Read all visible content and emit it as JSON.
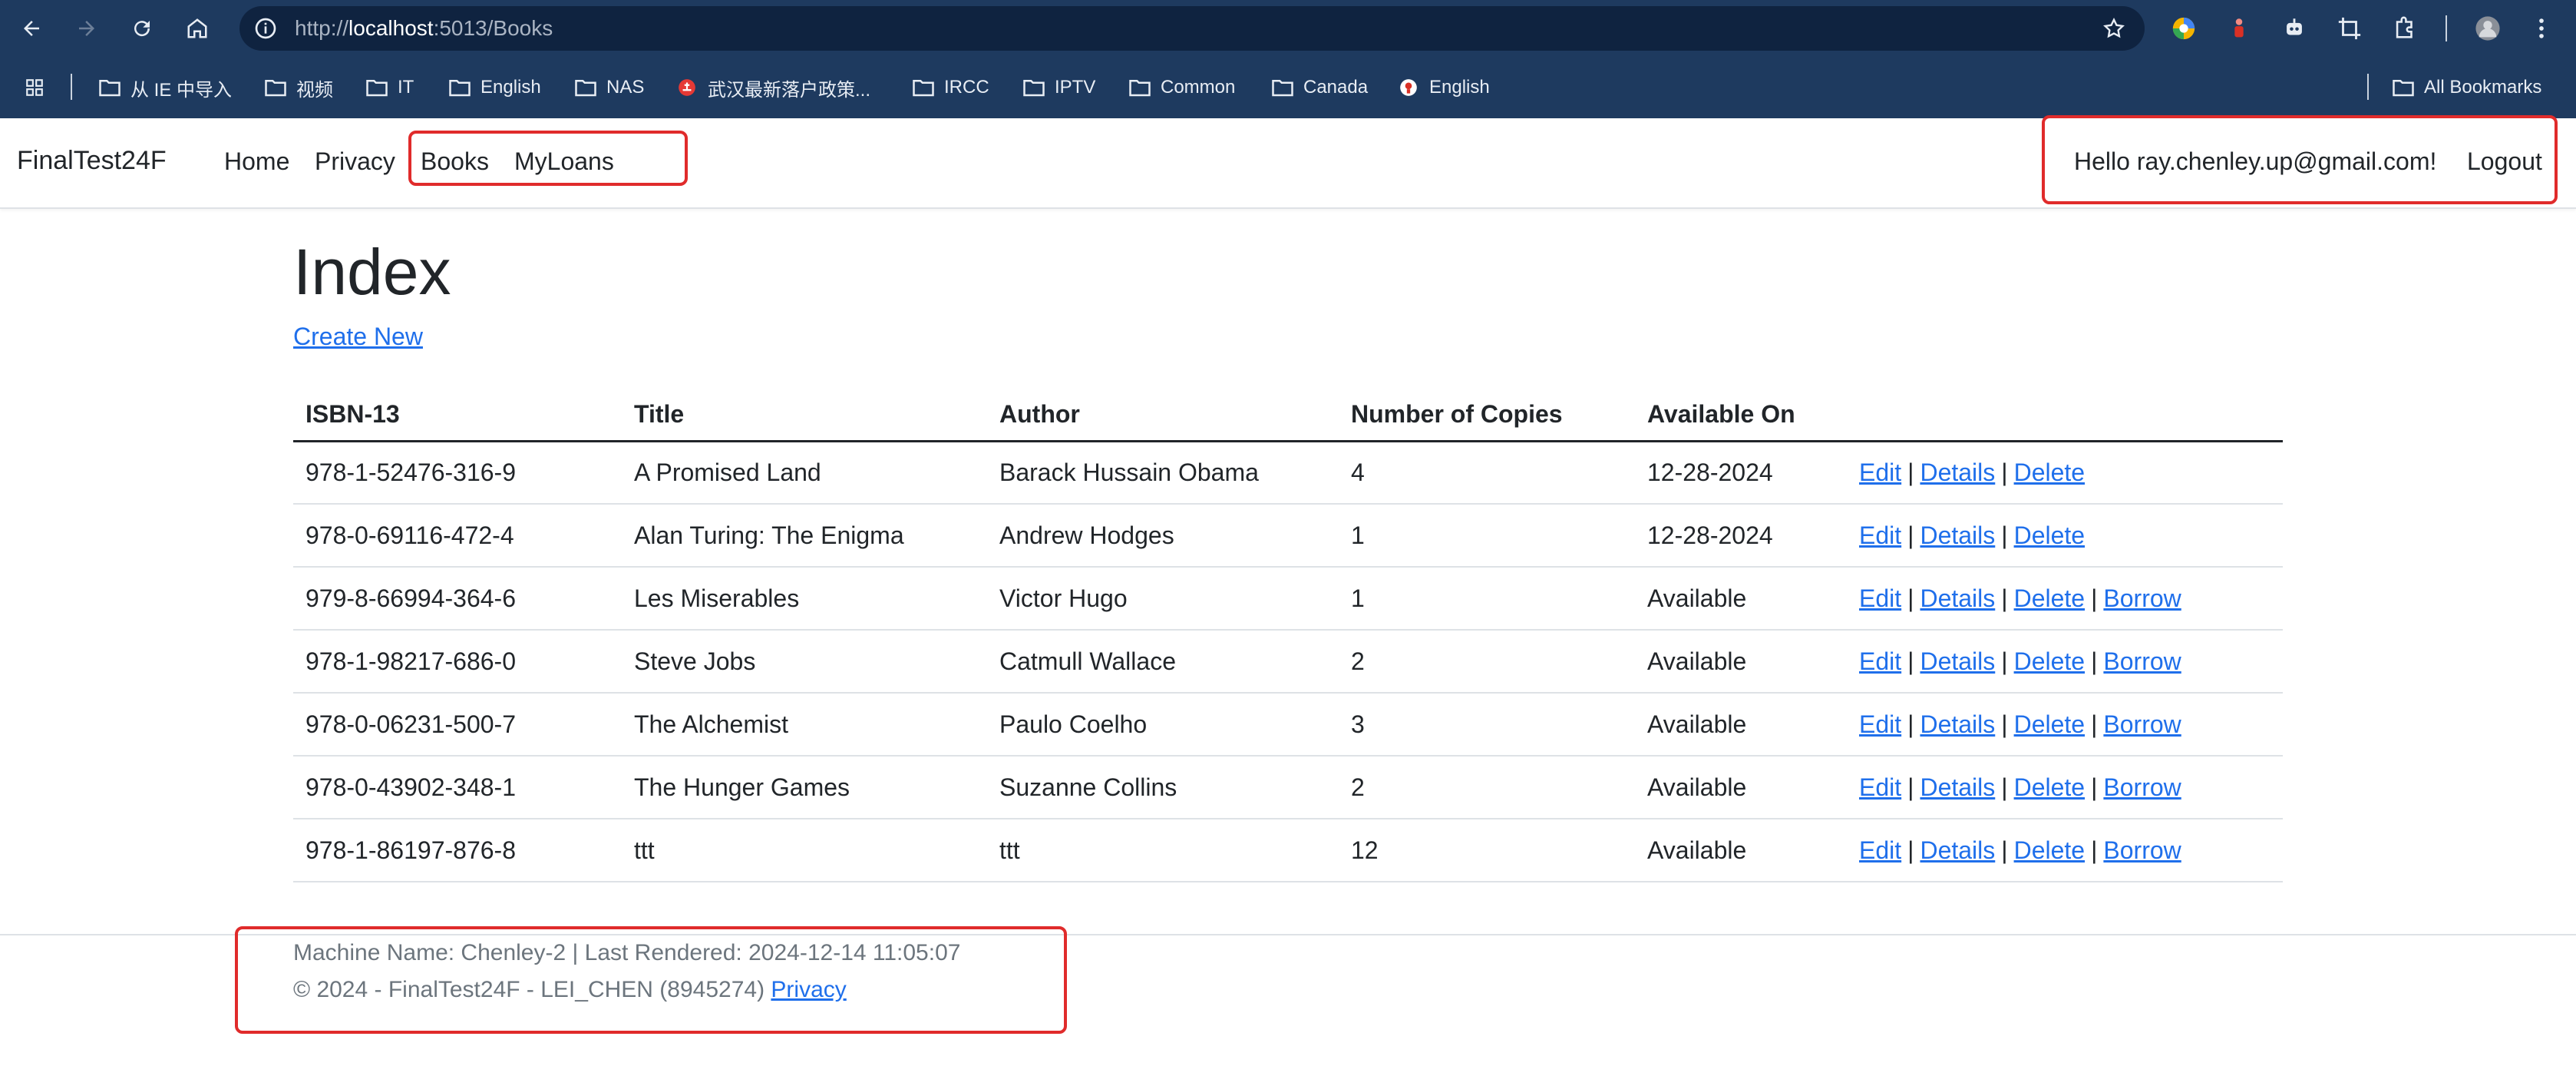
{
  "browser": {
    "url_host": "localhost",
    "url_prefix": "http://",
    "url_suffix": ":5013/Books",
    "bookmarks": [
      "从 IE 中导入",
      "视频",
      "IT",
      "English",
      "NAS",
      "武汉最新落户政策...",
      "IRCC",
      "IPTV",
      "Common",
      "Canada",
      "English"
    ],
    "all_bookmarks": "All Bookmarks"
  },
  "navbar": {
    "brand": "FinalTest24F",
    "home": "Home",
    "privacy": "Privacy",
    "books": "Books",
    "myloans": "MyLoans",
    "greeting": "Hello ray.chenley.up@gmail.com!",
    "logout": "Logout"
  },
  "page": {
    "title": "Index",
    "create_new": "Create New"
  },
  "table": {
    "headers": [
      "ISBN-13",
      "Title",
      "Author",
      "Number of Copies",
      "Available On"
    ],
    "rows": [
      {
        "isbn": "978-1-52476-316-9",
        "title": "A Promised Land",
        "author": "Barack Hussain Obama",
        "copies": "4",
        "available": "12-28-2024",
        "borrow": false
      },
      {
        "isbn": "978-0-69116-472-4",
        "title": "Alan Turing: The Enigma",
        "author": "Andrew Hodges",
        "copies": "1",
        "available": "12-28-2024",
        "borrow": false
      },
      {
        "isbn": "979-8-66994-364-6",
        "title": "Les Miserables",
        "author": "Victor Hugo",
        "copies": "1",
        "available": "Available",
        "borrow": true
      },
      {
        "isbn": "978-1-98217-686-0",
        "title": "Steve Jobs",
        "author": "Catmull Wallace",
        "copies": "2",
        "available": "Available",
        "borrow": true
      },
      {
        "isbn": "978-0-06231-500-7",
        "title": "The Alchemist",
        "author": "Paulo Coelho",
        "copies": "3",
        "available": "Available",
        "borrow": true
      },
      {
        "isbn": "978-0-43902-348-1",
        "title": "The Hunger Games",
        "author": "Suzanne Collins",
        "copies": "2",
        "available": "Available",
        "borrow": true
      },
      {
        "isbn": "978-1-86197-876-8",
        "title": "ttt",
        "author": "ttt",
        "copies": "12",
        "available": "Available",
        "borrow": true
      }
    ],
    "actions": {
      "edit": "Edit",
      "details": "Details",
      "delete": "Delete",
      "borrow": "Borrow",
      "separator": "|"
    }
  },
  "footer": {
    "machine": "Machine Name: Chenley-2 | Last Rendered: 2024-12-14 11:05:07",
    "copyright": "© 2024 - FinalTest24F - LEI_CHEN (8945274)",
    "privacy": "Privacy"
  },
  "colors": {
    "chrome": "#1e3a5f",
    "omnibox": "#0f2340",
    "link": "#1f6feb",
    "highlight": "#e02b2b"
  }
}
